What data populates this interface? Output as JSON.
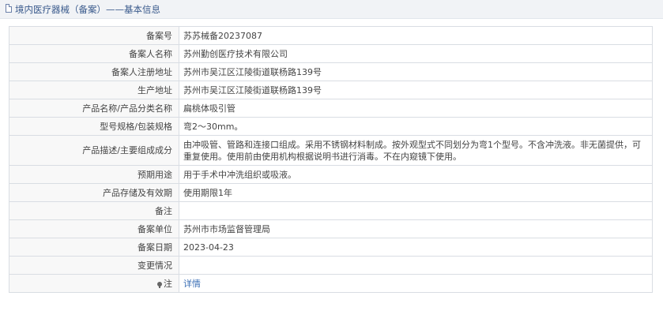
{
  "header": {
    "title": "境内医疗器械（备案）——基本信息"
  },
  "record": {
    "rows": [
      {
        "label": "备案号",
        "value": "苏苏械备20237087"
      },
      {
        "label": "备案人名称",
        "value": "苏州勤创医疗技术有限公司"
      },
      {
        "label": "备案人注册地址",
        "value": "苏州市吴江区江陵街道联杨路139号"
      },
      {
        "label": "生产地址",
        "value": "苏州市吴江区江陵街道联杨路139号"
      },
      {
        "label": "产品名称/产品分类名称",
        "value": "扁桃体吸引管"
      },
      {
        "label": "型号规格/包装规格",
        "value": "弯2～30mm。"
      },
      {
        "label": "产品描述/主要组成成分",
        "value": "由冲吸管、管路和连接口组成。采用不锈钢材料制成。按外观型式不同划分为弯1个型号。不含冲洗液。非无菌提供，可重复使用。使用前由使用机构根据说明书进行消毒。不在内窥镜下使用。"
      },
      {
        "label": "预期用途",
        "value": "用于手术中冲洗组织或吸液。"
      },
      {
        "label": "产品存储及有效期",
        "value": "使用期限1年"
      },
      {
        "label": "备注",
        "value": ""
      },
      {
        "label": "备案单位",
        "value": "苏州市市场监督管理局"
      },
      {
        "label": "备案日期",
        "value": "2023-04-23"
      },
      {
        "label": "变更情况",
        "value": ""
      }
    ],
    "note": {
      "label": "注",
      "link": "详情"
    }
  }
}
